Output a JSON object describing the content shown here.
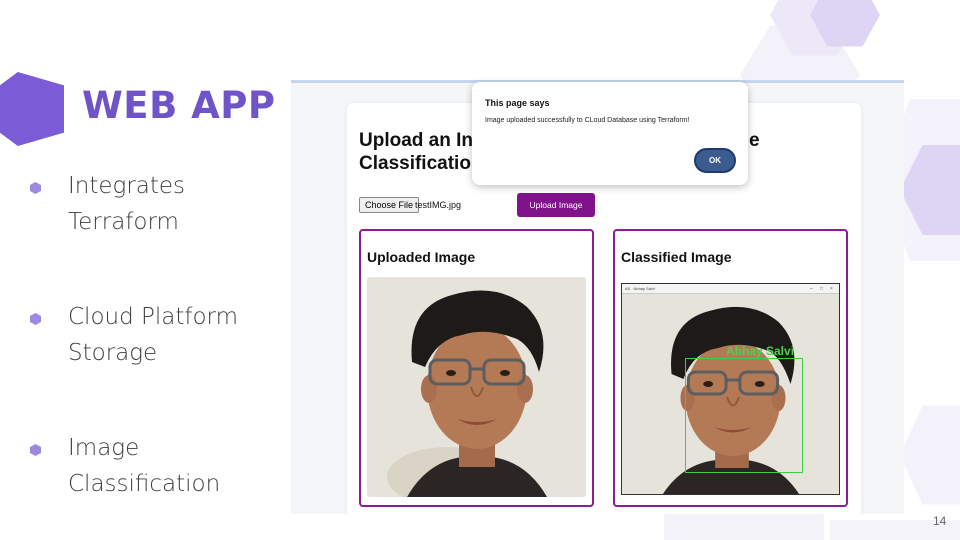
{
  "slide": {
    "title": "WEB APP",
    "page_number": "14",
    "bullets": [
      {
        "line1": "Integrates",
        "line2": "Terraform"
      },
      {
        "line1": "Cloud Platform",
        "line2": "Storage"
      },
      {
        "line1": "Image",
        "line2": "Classification"
      }
    ]
  },
  "app": {
    "heading_line1": "Upload an In",
    "heading_line1_tail": "e",
    "heading_line2": "Classificatio",
    "choose_file_label": "Choose File",
    "file_name": "testIMG.jpg",
    "upload_button": "Upload Image",
    "uploaded_panel_title": "Uploaded Image",
    "classified_panel_title": "Classified Image",
    "detection_label": "Abhay Salvi",
    "viewer_title": "AS · Abhay Salvi"
  },
  "dialog": {
    "title": "This page says",
    "message": "Image uploaded successfully to CLoud Database using Terraform!",
    "ok_label": "OK"
  },
  "colors": {
    "accent": "#6e54c8",
    "panel_border": "#8a1c96",
    "upload_button": "#80138a",
    "detection_box": "#3fce3f"
  }
}
